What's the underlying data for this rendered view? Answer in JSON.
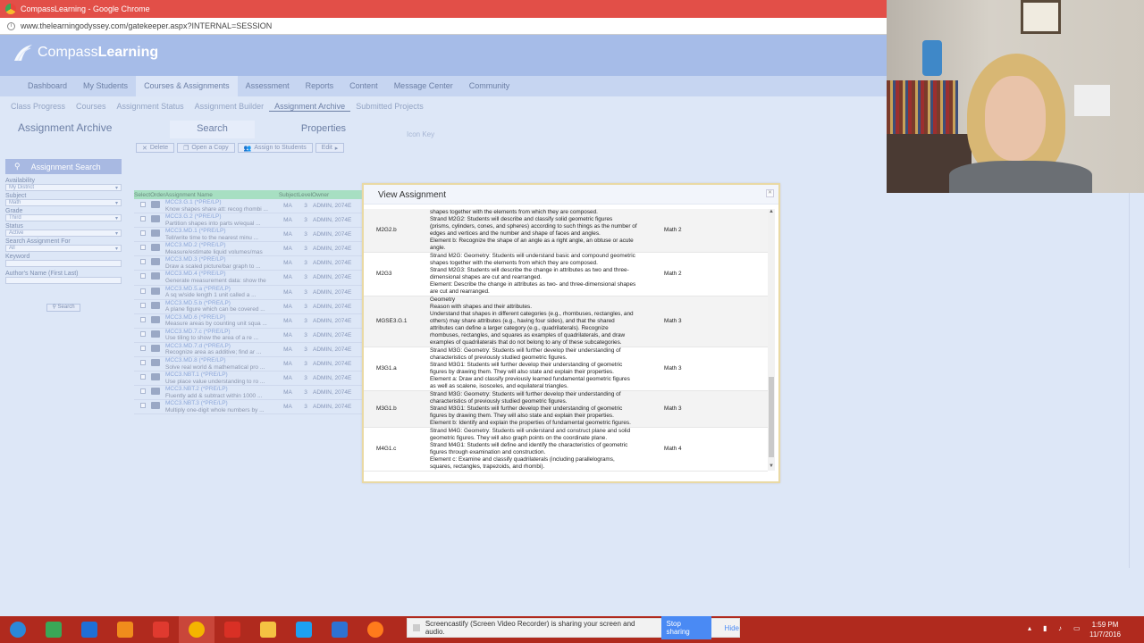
{
  "browser": {
    "title": "CompassLearning - Google Chrome",
    "url": "www.thelearningodyssey.com/gatekeeper.aspx?INTERNAL=SESSION"
  },
  "brand": {
    "name_light": "Compass",
    "name_bold": "Learning"
  },
  "nav": {
    "items": [
      "Dashboard",
      "My Students",
      "Courses & Assignments",
      "Assessment",
      "Reports",
      "Content",
      "Message Center",
      "Community"
    ],
    "active_index": 2
  },
  "subnav": {
    "items": [
      "Class Progress",
      "Courses",
      "Assignment Status",
      "Assignment Builder",
      "Assignment Archive",
      "Submitted Projects"
    ],
    "active_index": 4
  },
  "page": {
    "title": "Assignment Archive",
    "tab_search": "Search",
    "tab_properties": "Properties",
    "icon_key": "Icon Key"
  },
  "toolbar": {
    "delete": "Delete",
    "open_copy": "Open a Copy",
    "assign": "Assign to Students",
    "edit": "Edit"
  },
  "sidebar": {
    "header": "Assignment Search",
    "availability_label": "Availability",
    "availability_value": "My District",
    "subject_label": "Subject",
    "subject_value": "Math",
    "grade_label": "Grade",
    "grade_value": "Third",
    "status_label": "Status",
    "status_value": "Active",
    "search_for_label": "Search Assignment For",
    "search_for_value": "All",
    "keyword_label": "Keyword",
    "author_label": "Author's Name (First Last)",
    "search_button": "Search"
  },
  "table": {
    "headers": [
      "Select",
      "Order",
      "Assignment Name",
      "Subject",
      "Level",
      "Owner"
    ],
    "rows": [
      {
        "code": "MCC3.G.1 (*PRE/LP)",
        "title": "Know shapes share att: recog rhombi ...",
        "subject": "MA",
        "level": "3",
        "owner": "ADMIN, 2074E"
      },
      {
        "code": "MCC3.G.2 (*PRE/LP)",
        "title": "Partition shapes into parts w/equal ...",
        "subject": "MA",
        "level": "3",
        "owner": "ADMIN, 2074E"
      },
      {
        "code": "MCC3.MD.1 (*PRE/LP)",
        "title": "Tell/write time to the nearest minu ...",
        "subject": "MA",
        "level": "3",
        "owner": "ADMIN, 2074E"
      },
      {
        "code": "MCC3.MD.2 (*PRE/LP)",
        "title": "Measure/estimate liquid volumes/mas",
        "subject": "MA",
        "level": "3",
        "owner": "ADMIN, 2074E"
      },
      {
        "code": "MCC3.MD.3 (*PRE/LP)",
        "title": "Draw a scaled picture/bar graph to ...",
        "subject": "MA",
        "level": "3",
        "owner": "ADMIN, 2074E"
      },
      {
        "code": "MCC3.MD.4 (*PRE/LP)",
        "title": "Generate measurement data: show the",
        "subject": "MA",
        "level": "3",
        "owner": "ADMIN, 2074E"
      },
      {
        "code": "MCC3.MD.5.a (*PRE/LP)",
        "title": "A sq w/side length 1 unit called a ...",
        "subject": "MA",
        "level": "3",
        "owner": "ADMIN, 2074E"
      },
      {
        "code": "MCC3.MD.5.b (*PRE/LP)",
        "title": "A plane figure which can be covered ...",
        "subject": "MA",
        "level": "3",
        "owner": "ADMIN, 2074E"
      },
      {
        "code": "MCC3.MD.6 (*PRE/LP)",
        "title": "Measure areas by counting unit squa ...",
        "subject": "MA",
        "level": "3",
        "owner": "ADMIN, 2074E"
      },
      {
        "code": "MCC3.MD.7.c (*PRE/LP)",
        "title": "Use tiling to show the area of a re ...",
        "subject": "MA",
        "level": "3",
        "owner": "ADMIN, 2074E"
      },
      {
        "code": "MCC3.MD.7.d (*PRE/LP)",
        "title": "Recognize area as additive; find ar ...",
        "subject": "MA",
        "level": "3",
        "owner": "ADMIN, 2074E"
      },
      {
        "code": "MCC3.MD.8 (*PRE/LP)",
        "title": "Solve real world & mathematical pro ...",
        "subject": "MA",
        "level": "3",
        "owner": "ADMIN, 2074E"
      },
      {
        "code": "MCC3.NBT.1 (*PRE/LP)",
        "title": "Use place value understanding to ro ...",
        "subject": "MA",
        "level": "3",
        "owner": "ADMIN, 2074E"
      },
      {
        "code": "MCC3.NBT.2 (*PRE/LP)",
        "title": "Fluently add & subtract within 1000 ...",
        "subject": "MA",
        "level": "3",
        "owner": "ADMIN, 2074E"
      },
      {
        "code": "MCC3.NBT.3 (*PRE/LP)",
        "title": "Multiply one-digit whole numbers by ...",
        "subject": "MA",
        "level": "3",
        "owner": "ADMIN, 2074E"
      }
    ]
  },
  "modal": {
    "title": "View Assignment",
    "rows": [
      {
        "code": "M2G2.b",
        "desc": [
          "shapes together with the elements from which they are composed.",
          "Strand M2G2: Students will describe and classify solid geometric figures",
          "(prisms, cylinders, cones, and spheres) according to such things as the number of",
          "edges and vertices and the number and shape of faces and angles.",
          "Element b: Recognize the shape of an angle as a right angle, an obtuse or acute",
          "angle."
        ],
        "course": "Math 2"
      },
      {
        "code": "M2G3",
        "desc": [
          "Strand M2G: Geometry: Students will understand basic and compound geometric",
          "shapes together with the elements from which they are composed.",
          "Strand M2G3: Students will describe the change in attributes as two and three-",
          "dimensional shapes are cut and rearranged.",
          "Element: Describe the change in attributes as two- and three-dimensional shapes",
          "are cut and rearranged."
        ],
        "course": "Math 2"
      },
      {
        "code": "MGSE3.G.1",
        "desc": [
          "Geometry",
          "Reason with shapes and their attributes.",
          "Understand that shapes in different categories (e.g., rhombuses, rectangles, and",
          "others) may share attributes (e.g., having four sides), and that the shared",
          "attributes can define a larger category (e.g., quadrilaterals). Recognize",
          "rhombuses, rectangles, and squares as examples of quadrilaterals, and draw",
          "examples of quadrilaterals that do not belong to any of these subcategories."
        ],
        "course": "Math 3"
      },
      {
        "code": "M3G1.a",
        "desc": [
          "Strand M3G: Geometry: Students will further develop their understanding of",
          "characteristics of previously studied geometric figures.",
          "Strand M3G1: Students will further develop their understanding of geometric",
          "figures by drawing them. They will also state and explain their properties.",
          "Element a: Draw and classify previously learned fundamental geometric figures",
          "as well as scalene, isosceles, and equilateral triangles."
        ],
        "course": "Math 3"
      },
      {
        "code": "M3G1.b",
        "desc": [
          "Strand M3G: Geometry: Students will further develop their understanding of",
          "characteristics of previously studied geometric figures.",
          "Strand M3G1: Students will further develop their understanding of geometric",
          "figures by drawing them. They will also state and explain their properties.",
          "Element b: Identify and explain the properties of fundamental geometric figures."
        ],
        "course": "Math 3"
      },
      {
        "code": "M4G1.c",
        "desc": [
          "Strand M4G: Geometry: Students will understand and construct plane and solid",
          "geometric figures. They will also graph points on the coordinate plane.",
          "Strand M4G1: Students will define and identify the characteristics of geometric",
          "figures through examination and construction.",
          "Element c: Examine and classify quadrilaterals (including parallelograms,",
          "squares, rectangles, trapezoids, and rhombi)."
        ],
        "course": "Math 4"
      }
    ]
  },
  "sharebar": {
    "message": "Screencastify (Screen Video Recorder) is sharing your screen and audio.",
    "stop": "Stop sharing",
    "hide": "Hide"
  },
  "taskbar": {
    "icons": [
      "windows-start",
      "screencast",
      "pse",
      "media-player",
      "acrobat",
      "chrome",
      "gmail",
      "file-explorer",
      "twitter",
      "app-grid",
      "firefox"
    ],
    "time": "1:59 PM",
    "date": "11/7/2016"
  }
}
